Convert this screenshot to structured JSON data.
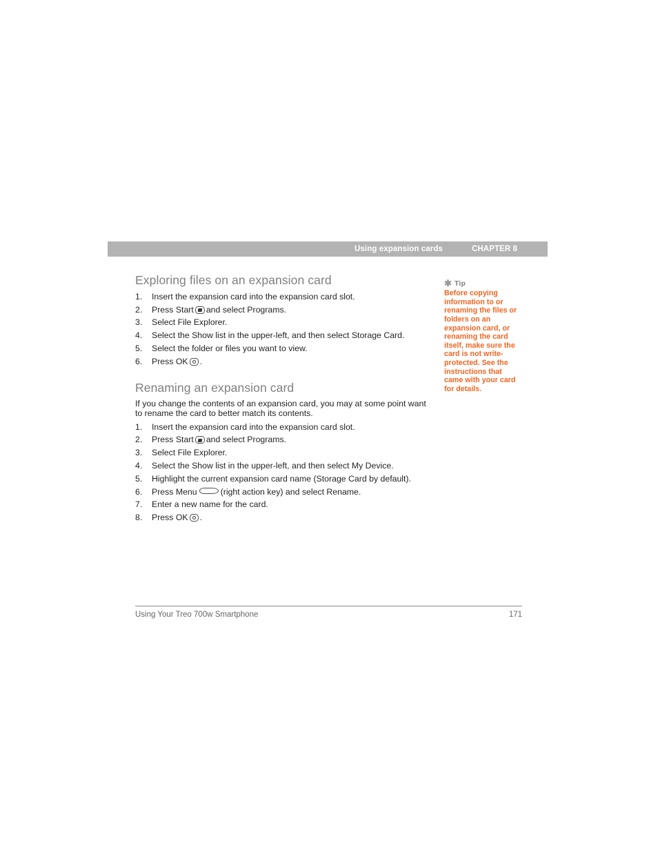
{
  "header": {
    "title": "Using expansion cards",
    "chapter": "CHAPTER 8"
  },
  "sections": [
    {
      "heading": "Exploring files on an expansion card",
      "steps": [
        {
          "num": "1.",
          "pre": "Insert the expansion card into the expansion card slot.",
          "icon": null,
          "post": ""
        },
        {
          "num": "2.",
          "pre": "Press Start",
          "icon": "start-key-icon",
          "post": "and select Programs."
        },
        {
          "num": "3.",
          "pre": "Select File Explorer.",
          "icon": null,
          "post": ""
        },
        {
          "num": "4.",
          "pre": "Select the Show list in the upper-left, and then select Storage Card.",
          "icon": null,
          "post": ""
        },
        {
          "num": "5.",
          "pre": "Select the folder or files you want to view.",
          "icon": null,
          "post": ""
        },
        {
          "num": "6.",
          "pre": "Press OK",
          "icon": "ok-key-icon",
          "post": "."
        }
      ]
    },
    {
      "heading": "Renaming an expansion card",
      "paragraph": "If you change the contents of an expansion card, you may at some point want to rename the card to better match its contents.",
      "steps": [
        {
          "num": "1.",
          "pre": "Insert the expansion card into the expansion card slot.",
          "icon": null,
          "post": ""
        },
        {
          "num": "2.",
          "pre": "Press Start",
          "icon": "start-key-icon",
          "post": "and select Programs."
        },
        {
          "num": "3.",
          "pre": "Select File Explorer.",
          "icon": null,
          "post": ""
        },
        {
          "num": "4.",
          "pre": "Select the Show list in the upper-left, and then select My Device.",
          "icon": null,
          "post": ""
        },
        {
          "num": "5.",
          "pre": "Highlight the current expansion card name (Storage Card by default).",
          "icon": null,
          "post": ""
        },
        {
          "num": "6.",
          "pre": "Press Menu",
          "icon": "menu-key-icon",
          "post": "(right action key) and select Rename."
        },
        {
          "num": "7.",
          "pre": "Enter a new name for the card.",
          "icon": null,
          "post": ""
        },
        {
          "num": "8.",
          "pre": "Press OK",
          "icon": "ok-key-icon",
          "post": "."
        }
      ]
    }
  ],
  "tip": {
    "icon": "asterisk-icon",
    "label": "Tip",
    "body": "Before copying information to or renaming the files or folders on an expansion card, or renaming the card itself, make sure the card is not write-protected. See the instructions that came with your card for details."
  },
  "footer": {
    "book_title": "Using Your Treo 700w Smartphone",
    "page_number": "171"
  },
  "colors": {
    "header_bar": "#b3b3b3",
    "heading_gray": "#808080",
    "tip_orange": "#f26522",
    "body_text": "#231f20",
    "footer_gray": "#666666"
  }
}
